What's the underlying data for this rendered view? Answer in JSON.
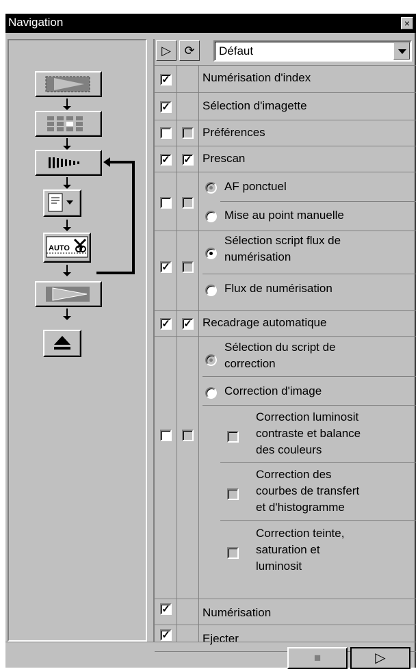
{
  "window": {
    "title": "Navigation",
    "close_glyph": "×"
  },
  "header": {
    "play_icon": "▷",
    "refresh_icon": "⟳",
    "preset": "Défaut"
  },
  "steps": [
    {
      "name": "index-scan-step"
    },
    {
      "name": "thumbnail-select-step"
    },
    {
      "name": "prescan-step"
    },
    {
      "name": "workflow-script-step"
    },
    {
      "name": "auto-crop-step"
    },
    {
      "name": "scan-step"
    },
    {
      "name": "eject-step"
    }
  ],
  "rows": {
    "num_index": "Numérisation d'index",
    "sel_imagette": "Sélection d'imagette",
    "preferences": "Préférences",
    "prescan": "Prescan",
    "af_ponctuel": "AF ponctuel",
    "mise_au_point": "Mise au point manuelle",
    "sel_script_1": "Sélection script flux de",
    "sel_script_2": "numérisation",
    "flux": "Flux de numérisation",
    "recadrage": "Recadrage automatique",
    "sel_corr_1": "Sélection du script de",
    "sel_corr_2": "correction",
    "corr_image": "Correction d'image",
    "corr_lum_1": "Correction luminosit",
    "corr_lum_2": "contraste et balance",
    "corr_lum_3": "des couleurs",
    "corr_courbes_1": "Correction des",
    "corr_courbes_2": "courbes de transfert",
    "corr_courbes_3": "et d'histogramme",
    "corr_teinte_1": "Correction teinte,",
    "corr_teinte_2": "saturation et",
    "corr_teinte_3": "luminosit",
    "numerisation": "Numérisation",
    "ejecter": "Ejecter"
  },
  "check_glyph": "✓",
  "footer": {
    "stop_icon": "■",
    "run_icon": "▷"
  }
}
